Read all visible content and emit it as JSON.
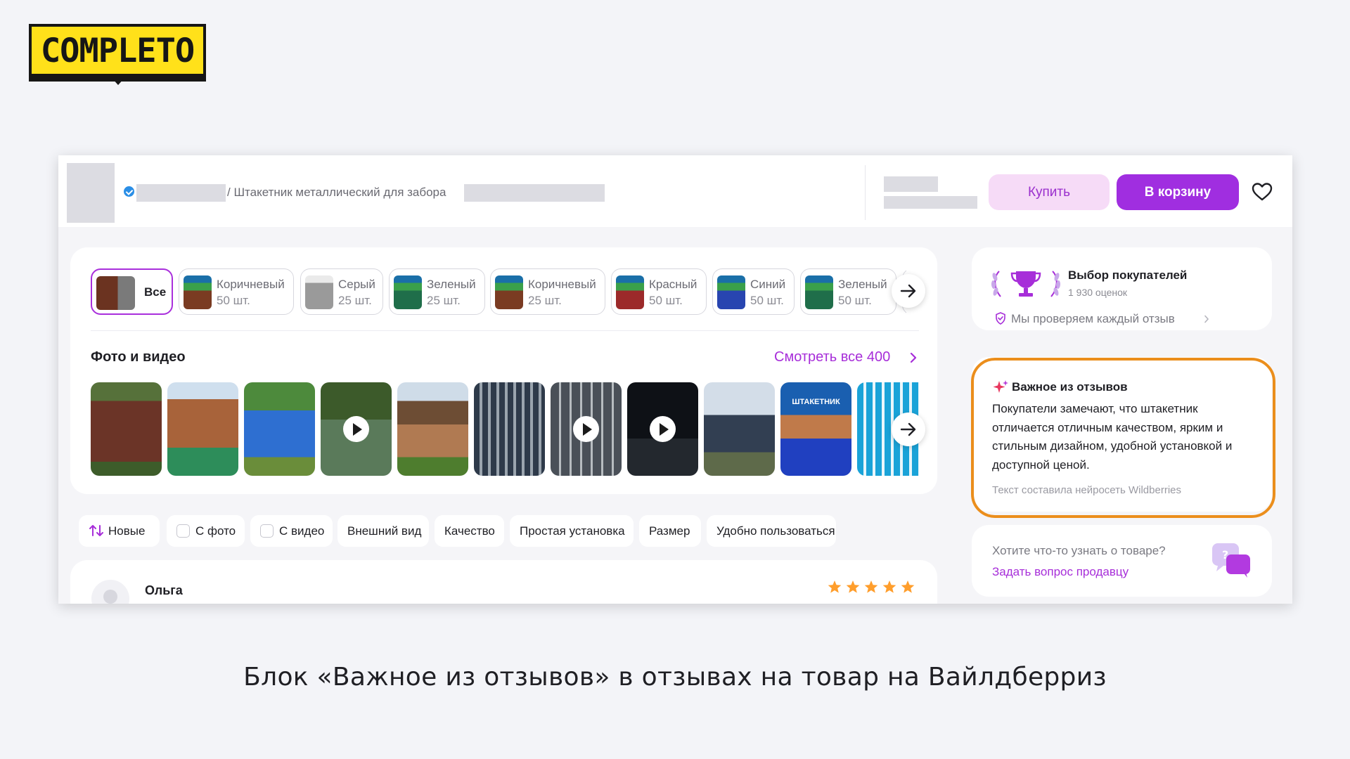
{
  "logo": {
    "text": "COMPLETO"
  },
  "topbar": {
    "breadcrumb": "/ Штакетник металлический для забора",
    "buy_label": "Купить",
    "cart_label": "В корзину"
  },
  "variants": [
    {
      "label": "Все",
      "count": "",
      "active": true
    },
    {
      "label": "Коричневый",
      "count": "50 шт."
    },
    {
      "label": "Серый",
      "count": "25 шт."
    },
    {
      "label": "Зеленый",
      "count": "25 шт."
    },
    {
      "label": "Коричневый",
      "count": "25 шт."
    },
    {
      "label": "Красный",
      "count": "50 шт."
    },
    {
      "label": "Синий",
      "count": "50 шт."
    },
    {
      "label": "Зеленый",
      "count": "50 шт."
    }
  ],
  "photos": {
    "title": "Фото и видео",
    "see_all": "Смотреть все 400",
    "items": [
      {
        "video": false
      },
      {
        "video": false
      },
      {
        "video": false
      },
      {
        "video": true
      },
      {
        "video": false
      },
      {
        "video": false
      },
      {
        "video": true
      },
      {
        "video": true
      },
      {
        "video": false
      },
      {
        "video": false,
        "banner_text": "ШТАКЕТНИК"
      },
      {
        "video": false
      }
    ]
  },
  "filters": {
    "sort_label": "Новые",
    "items": [
      "С фото",
      "С видео",
      "Внешний вид",
      "Качество",
      "Простая установка",
      "Размер",
      "Удобно пользоваться"
    ]
  },
  "review": {
    "author": "Ольга",
    "rating": 5
  },
  "rating_card": {
    "title": "Выбор покупателей",
    "subtitle": "1 930 оценок",
    "check_text": "Мы проверяем каждый отзыв"
  },
  "important": {
    "title": "Важное из отзывов",
    "text": "Покупатели замечают, что штакетник отличается отличным качеством, ярким и стильным дизайном, удобной установкой и доступной ценой.",
    "footnote": "Текст составила нейросеть Wildberries"
  },
  "question": {
    "text": "Хотите что-то узнать о товаре?",
    "link": "Задать вопрос продавцу"
  },
  "caption": "Блок «Важное из отзывов» в отзывах на товар на Вайлдберриз",
  "colors": {
    "accent": "#a72ed9",
    "highlight": "#eb8e1c",
    "logo_yellow": "#ffe11a"
  }
}
